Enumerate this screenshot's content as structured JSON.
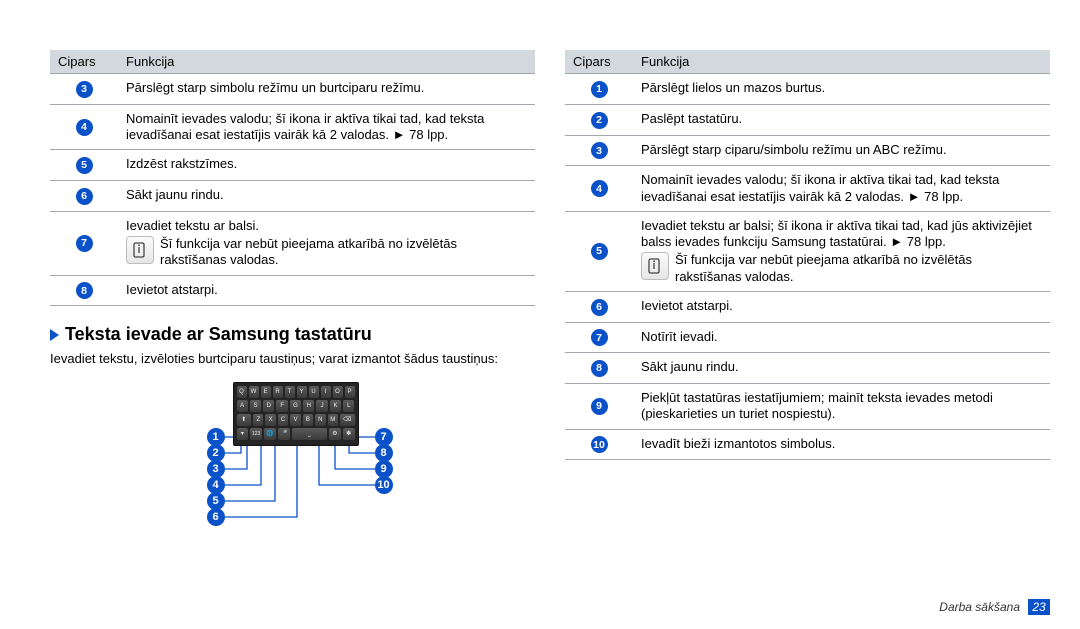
{
  "left_table": {
    "col1": "Cipars",
    "col2": "Funkcija",
    "rows": [
      {
        "n": "3",
        "text": "Pārslēgt starp simbolu režīmu un burtciparu režīmu."
      },
      {
        "n": "4",
        "text": "Nomainīt ievades valodu; šī ikona ir aktīva tikai tad, kad teksta ievadīšanai esat iestatījis vairāk kā 2 valodas. ► 78 lpp."
      },
      {
        "n": "5",
        "text": "Izdzēst rakstzīmes."
      },
      {
        "n": "6",
        "text": "Sākt jaunu rindu."
      },
      {
        "n": "7",
        "text": "Ievadiet tekstu ar balsi.",
        "note": "Šī funkcija var nebūt pieejama atkarībā no izvēlētās rakstīšanas valodas."
      },
      {
        "n": "8",
        "text": "Ievietot atstarpi."
      }
    ]
  },
  "section": {
    "title": "Teksta ievade ar Samsung tastatūru",
    "desc": "Ievadiet tekstu, izvēloties burtciparu taustiņus; varat izmantot šādus taustiņus:"
  },
  "kb_rows": [
    [
      "Q",
      "W",
      "E",
      "R",
      "T",
      "Y",
      "U",
      "I",
      "O",
      "P"
    ],
    [
      "A",
      "S",
      "D",
      "F",
      "G",
      "H",
      "J",
      "K",
      "L"
    ],
    [
      "Z",
      "X",
      "C",
      "V",
      "B",
      "N",
      "M"
    ]
  ],
  "right_table": {
    "col1": "Cipars",
    "col2": "Funkcija",
    "rows": [
      {
        "n": "1",
        "text": "Pārslēgt lielos un mazos burtus."
      },
      {
        "n": "2",
        "text": "Paslēpt tastatūru."
      },
      {
        "n": "3",
        "text": "Pārslēgt starp ciparu/simbolu režīmu un ABC režīmu."
      },
      {
        "n": "4",
        "text": "Nomainīt ievades valodu; šī ikona ir aktīva tikai tad, kad teksta ievadīšanai esat iestatījis vairāk kā 2 valodas. ► 78 lpp."
      },
      {
        "n": "5",
        "text": "Ievadiet tekstu ar balsi; šī ikona ir aktīva tikai tad, kad jūs aktivizējiet balss ievades funkciju Samsung tastatūrai. ► 78 lpp.",
        "note": "Šī funkcija var nebūt pieejama atkarībā no izvēlētās rakstīšanas valodas."
      },
      {
        "n": "6",
        "text": "Ievietot atstarpi."
      },
      {
        "n": "7",
        "text": "Notīrīt ievadi."
      },
      {
        "n": "8",
        "text": "Sākt jaunu rindu."
      },
      {
        "n": "9",
        "text": "Piekļūt tastatūras iestatījumiem; mainīt teksta ievades metodi (pieskarieties un turiet nospiestu)."
      },
      {
        "n": "10",
        "text": "Ievadīt bieži izmantotos simbolus."
      }
    ]
  },
  "footer": {
    "section": "Darba sākšana",
    "page": "23"
  }
}
